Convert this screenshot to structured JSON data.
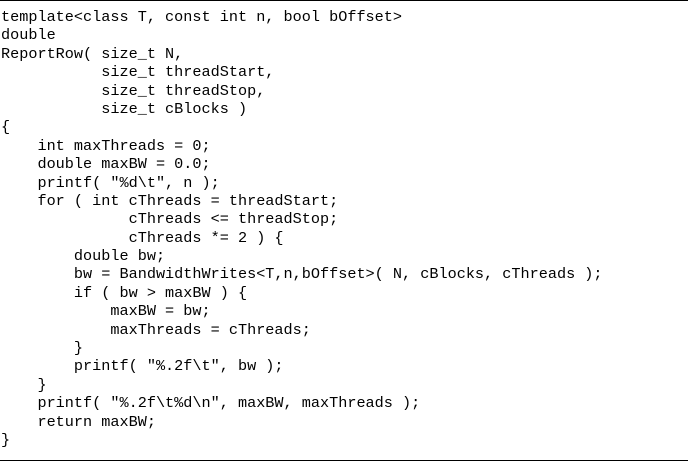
{
  "code": {
    "lines": [
      "template<class T, const int n, bool bOffset>",
      "double",
      "ReportRow( size_t N,",
      "           size_t threadStart,",
      "           size_t threadStop,",
      "           size_t cBlocks )",
      "{",
      "    int maxThreads = 0;",
      "    double maxBW = 0.0;",
      "    printf( \"%d\\t\", n );",
      "    for ( int cThreads = threadStart;",
      "              cThreads <= threadStop;",
      "              cThreads *= 2 ) {",
      "        double bw;",
      "        bw = BandwidthWrites<T,n,bOffset>( N, cBlocks, cThreads );",
      "        if ( bw > maxBW ) {",
      "            maxBW = bw;",
      "            maxThreads = cThreads;",
      "        }",
      "        printf( \"%.2f\\t\", bw );",
      "    }",
      "    printf( \"%.2f\\t%d\\n\", maxBW, maxThreads );",
      "    return maxBW;",
      "}"
    ]
  }
}
